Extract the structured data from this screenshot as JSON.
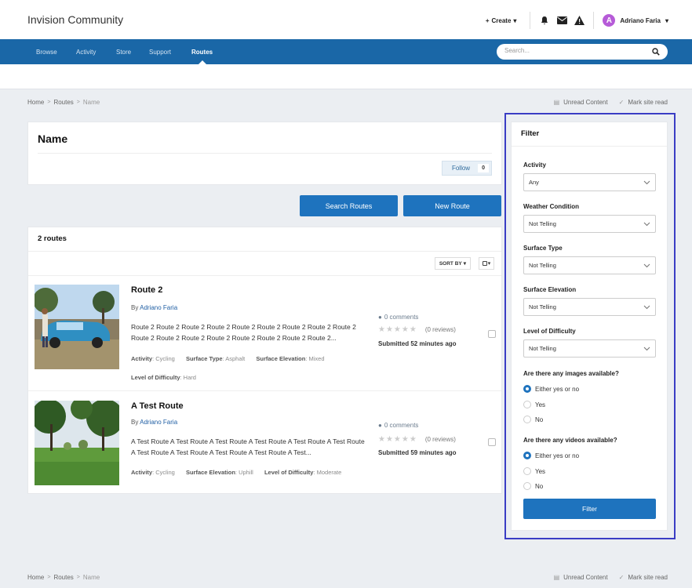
{
  "header": {
    "brand": "Invision Community",
    "create_label": "Create",
    "user_name": "Adriano Faria",
    "avatar_letter": "A"
  },
  "nav": {
    "items": [
      {
        "label": "Browse",
        "active": false
      },
      {
        "label": "Activity",
        "active": false
      },
      {
        "label": "Store",
        "active": false
      },
      {
        "label": "Support",
        "active": false
      },
      {
        "label": "Routes",
        "active": true
      }
    ],
    "search_placeholder": "Search..."
  },
  "breadcrumb": {
    "items": [
      "Home",
      "Routes",
      "Name"
    ],
    "separator": ">"
  },
  "top_links": {
    "unread": "Unread Content",
    "mark_read": "Mark site read"
  },
  "page": {
    "title": "Name",
    "follow_label": "Follow",
    "follow_count": "0",
    "search_routes_label": "Search Routes",
    "new_route_label": "New Route"
  },
  "list": {
    "count_label": "2 routes",
    "sort_label": "SORT BY",
    "routes": [
      {
        "title": "Route 2",
        "by": "By",
        "author": "Adriano Faria",
        "description": "Route 2 Route 2 Route 2 Route 2 Route 2 Route 2 Route 2 Route 2 Route 2 Route 2 Route 2 Route 2 Route 2 Route 2 Route 2 Route 2 Route 2...",
        "meta": [
          {
            "key": "Activity",
            "value": ": Cycling"
          },
          {
            "key": "Surface Type",
            "value": ": Asphalt"
          },
          {
            "key": "Surface Elevation",
            "value": ": Mixed"
          },
          {
            "key": "Level of Difficulty",
            "value": ": Hard"
          }
        ],
        "comments": "0 comments",
        "reviews": "(0 reviews)",
        "submitted": "Submitted 52 minutes ago"
      },
      {
        "title": "A Test Route",
        "by": "By",
        "author": "Adriano Faria",
        "description": "A Test Route A Test Route A Test Route A Test Route A Test Route A Test Route A Test Route A Test Route A Test Route A Test Route A Test...",
        "meta": [
          {
            "key": "Activity",
            "value": ": Cycling"
          },
          {
            "key": "Surface Elevation",
            "value": ": Uphill"
          },
          {
            "key": "Level of Difficulty",
            "value": ": Moderate"
          }
        ],
        "comments": "0 comments",
        "reviews": "(0 reviews)",
        "submitted": "Submitted 59 minutes ago"
      }
    ]
  },
  "filter": {
    "title": "Filter",
    "selects": [
      {
        "label": "Activity",
        "value": "Any"
      },
      {
        "label": "Weather Condition",
        "value": "Not Telling"
      },
      {
        "label": "Surface Type",
        "value": "Not Telling"
      },
      {
        "label": "Surface Elevation",
        "value": "Not Telling"
      },
      {
        "label": "Level of Difficulty",
        "value": "Not Telling"
      }
    ],
    "images_q": "Are there any images available?",
    "videos_q": "Are there any videos available?",
    "options": [
      "Either yes or no",
      "Yes",
      "No"
    ],
    "images_selected": "Either yes or no",
    "videos_selected": "Either yes or no",
    "submit_label": "Filter"
  },
  "colors": {
    "nav": "#1a67a7",
    "accent": "#1e73be",
    "highlight_border": "#3a3dc4",
    "avatar": "#b65bd8"
  }
}
